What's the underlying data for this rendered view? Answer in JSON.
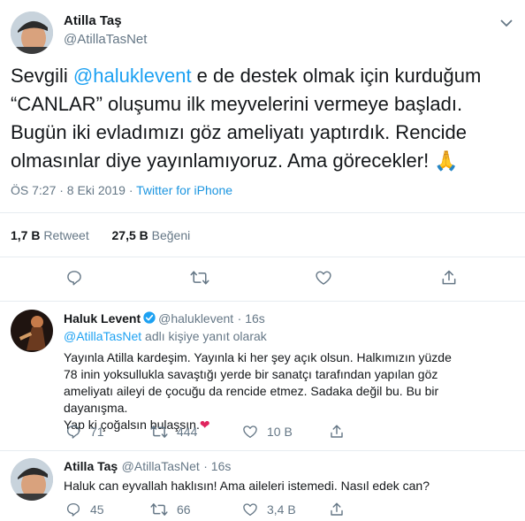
{
  "main_tweet": {
    "author_name": "Atilla Taş",
    "author_handle": "@AtillaTasNet",
    "text_part1": "Sevgili ",
    "mention": "@haluklevent",
    "text_part2": " e de destek olmak için kurduğum “CANLAR” oluşumu ilk meyvelerini vermeye başladı. Bugün iki evladımızı göz ameliyatı yaptırdık. Rencide olmasınlar diye yayınlamıyoruz. Ama görecekler! ",
    "emoji": "🙏",
    "timestamp": "ÖS 7:27 · 8 Eki 2019 · ",
    "source": "Twitter for iPhone",
    "retweet_count": "1,7 B",
    "retweet_label": "Retweet",
    "like_count": "27,5 B",
    "like_label": "Beğeni"
  },
  "replies": [
    {
      "author_name": "Haluk Levent",
      "verified": true,
      "author_handle": "@haluklevent",
      "time": "· 16s",
      "replying_to": "@AtillaTasNet",
      "replying_suffix": " adlı kişiye yanıt olarak",
      "text": "Yayınla Atilla kardeşim. Yayınla ki her şey açık olsun. Halkımızın yüzde 78 inin yoksullukla savaştığı yerde bir sanatçı tarafından yapılan göz ameliyatı aileyi de çocuğu da rencide etmez. Sadaka değil bu. Bu bir dayanışma.",
      "text_last": "Yap ki çoğalsın bulaşsın.",
      "emoji": "❤",
      "reply_count": "71",
      "retweet_count": "444",
      "like_count": "10 B"
    },
    {
      "author_name": "Atilla Taş",
      "author_handle": "@AtillaTasNet",
      "time": "· 16s",
      "text": "Haluk can eyvallah haklısın! Ama aileleri istemedi. Nasıl edek can?",
      "reply_count": "45",
      "retweet_count": "66",
      "like_count": "3,4 B"
    }
  ],
  "icons": [
    "chevron-down-icon",
    "reply-icon",
    "retweet-icon",
    "like-icon",
    "share-icon",
    "verified-icon"
  ],
  "colors": {
    "accent": "#1da1f2",
    "secondary_text": "#657786",
    "divider": "#e6ecf0",
    "heart": "#e0245e"
  }
}
